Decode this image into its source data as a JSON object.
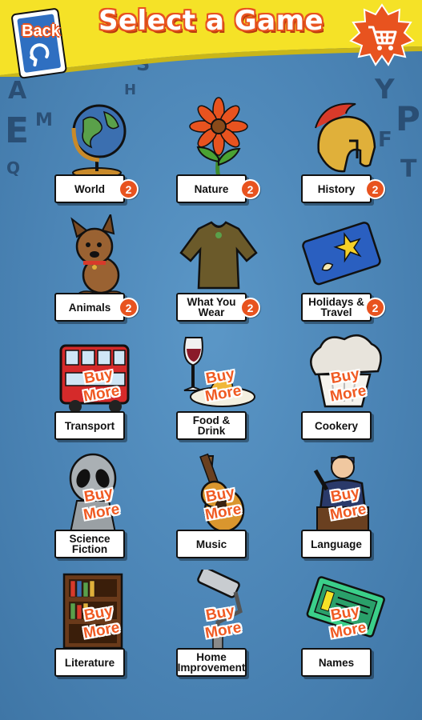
{
  "header": {
    "title": "Select a Game",
    "back_label": "Back",
    "shop_icon": "cart-icon"
  },
  "background_letters": [
    "A",
    "E",
    "M",
    "Q",
    "S",
    "H",
    "Y",
    "P",
    "F",
    "T"
  ],
  "colors": {
    "accent": "#e8531f",
    "background": "#4d86b7",
    "header": "#f5e227"
  },
  "games": [
    {
      "label": "World",
      "badge": "2",
      "icon": "globe-icon",
      "locked": false
    },
    {
      "label": "Nature",
      "badge": "2",
      "icon": "flower-icon",
      "locked": false
    },
    {
      "label": "History",
      "badge": "2",
      "icon": "helmet-icon",
      "locked": false
    },
    {
      "label": "Animals",
      "badge": "2",
      "icon": "dog-icon",
      "locked": false
    },
    {
      "label": "What You Wear",
      "badge": "2",
      "icon": "sweater-icon",
      "locked": false
    },
    {
      "label": "Holidays & Travel",
      "badge": "2",
      "icon": "towel-icon",
      "locked": false
    },
    {
      "label": "Transport",
      "buy": "Buy More",
      "icon": "bus-icon",
      "locked": true
    },
    {
      "label": "Food & Drink",
      "buy": "Buy More",
      "icon": "wine-icon",
      "locked": true
    },
    {
      "label": "Cookery",
      "buy": "Buy More",
      "icon": "chef-hat-icon",
      "locked": true
    },
    {
      "label": "Science Fiction",
      "buy": "Buy More",
      "icon": "alien-icon",
      "locked": true
    },
    {
      "label": "Music",
      "buy": "Buy More",
      "icon": "guitar-icon",
      "locked": true
    },
    {
      "label": "Language",
      "buy": "Buy More",
      "icon": "speaker-icon",
      "locked": true
    },
    {
      "label": "Literature",
      "buy": "Buy More",
      "icon": "bookcase-icon",
      "locked": true
    },
    {
      "label": "Home Improvement",
      "buy": "Buy More",
      "icon": "paint-roller-icon",
      "locked": true
    },
    {
      "label": "Names",
      "buy": "Buy More",
      "icon": "nameplate-icon",
      "locked": true
    }
  ]
}
